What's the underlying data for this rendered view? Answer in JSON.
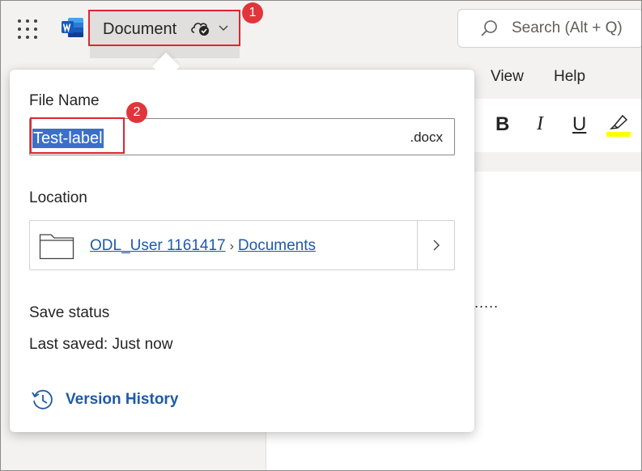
{
  "app": {
    "name": "Word"
  },
  "header": {
    "doc_title": "Document",
    "search_placeholder": "Search (Alt + Q)"
  },
  "menu": [
    {
      "label": "View"
    },
    {
      "label": "Help"
    }
  ],
  "ribbon": {
    "bold": "B",
    "italic": "I",
    "underline": "U",
    "highlight_color": "#ffff00"
  },
  "document": {
    "content": "....."
  },
  "popup": {
    "file_name_label": "File Name",
    "file_name_value": "Test-label",
    "file_extension": ".docx",
    "location_label": "Location",
    "location_path": [
      {
        "label": "ODL_User 1161417"
      },
      {
        "label": "Documents"
      }
    ],
    "save_status_label": "Save status",
    "last_saved": "Last saved: Just now",
    "version_history": "Version History"
  },
  "callouts": [
    {
      "number": "1"
    },
    {
      "number": "2"
    }
  ],
  "colors": {
    "accent": "#1f5aa6",
    "selection": "#3b6fc9",
    "callout_red": "#e0252f"
  }
}
